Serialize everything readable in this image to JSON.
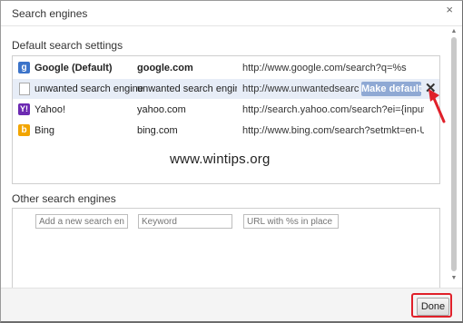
{
  "dialog": {
    "title": "Search engines",
    "close_glyph": "×"
  },
  "default_section": {
    "title": "Default search settings",
    "engines": [
      {
        "name": "Google (Default)",
        "keyword": "google.com",
        "url": "http://www.google.com/search?q=%s",
        "icon": "google-favicon",
        "bold": true
      },
      {
        "name": "unwanted search engine",
        "keyword": "unwanted search engine",
        "url": "http://www.unwantedsearch.c...",
        "icon": "page-icon",
        "bold": false
      },
      {
        "name": "Yahoo!",
        "keyword": "yahoo.com",
        "url": "http://search.yahoo.com/search?ei={inputEncodi...",
        "icon": "yahoo-favicon",
        "bold": false
      },
      {
        "name": "Bing",
        "keyword": "bing.com",
        "url": "http://www.bing.com/search?setmkt=en-US&q=...",
        "icon": "bing-favicon",
        "bold": false
      }
    ],
    "make_default_label": "Make default",
    "remove_glyph": "✕"
  },
  "watermark": "www.wintips.org",
  "other_section": {
    "title": "Other search engines",
    "name_placeholder": "Add a new search engine",
    "keyword_placeholder": "Keyword",
    "url_placeholder": "URL with %s in place of qu"
  },
  "footer": {
    "done_label": "Done"
  },
  "colors": {
    "annotation_red": "#e0202a",
    "highlight_row": "#e7edf7",
    "make_default_bg": "#8fa9d4"
  }
}
